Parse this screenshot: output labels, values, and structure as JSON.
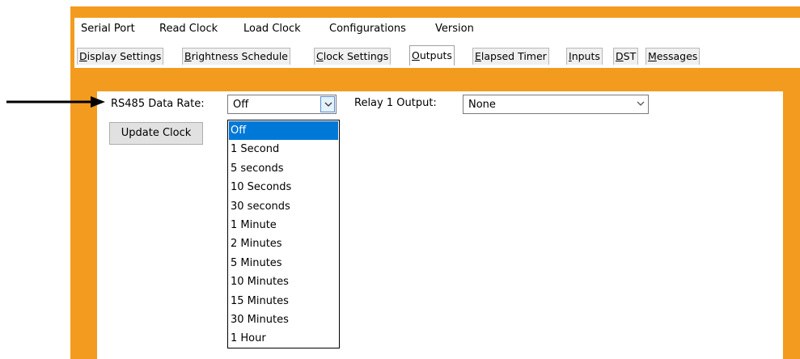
{
  "menu": [
    "Serial Port",
    "Read Clock",
    "Load Clock",
    "Configurations",
    "Version"
  ],
  "tabs": [
    {
      "label": "Display Settings",
      "underline": "D",
      "rest": "isplay Settings"
    },
    {
      "label": "Brightness Schedule",
      "underline": "B",
      "rest": "rightness Schedule"
    },
    {
      "label": "Clock Settings",
      "underline": "C",
      "rest": "lock Settings"
    },
    {
      "label": "Outputs",
      "underline": "O",
      "rest": "utputs",
      "active": true
    },
    {
      "label": "Elapsed Timer",
      "underline": "E",
      "rest": "lapsed Timer"
    },
    {
      "label": "Inputs",
      "underline": "I",
      "rest": "nputs"
    },
    {
      "label": "DST",
      "underline": "D",
      "rest": "ST"
    },
    {
      "label": "Messages",
      "underline": "M",
      "rest": "essages"
    }
  ],
  "rs485": {
    "label": "RS485 Data Rate:",
    "value": "Off",
    "options": [
      "Off",
      "1 Second",
      "5 seconds",
      "10 Seconds",
      "30 seconds",
      "1 Minute",
      "2 Minutes",
      "5 Minutes",
      "10 Minutes",
      "15 Minutes",
      "30 Minutes",
      "1 Hour"
    ],
    "selected_index": 0
  },
  "relay1": {
    "label": "Relay 1 Output:",
    "value": "None"
  },
  "update_button": "Update Clock",
  "colors": {
    "frame": "#f39b1f",
    "selection": "#0078d7"
  }
}
